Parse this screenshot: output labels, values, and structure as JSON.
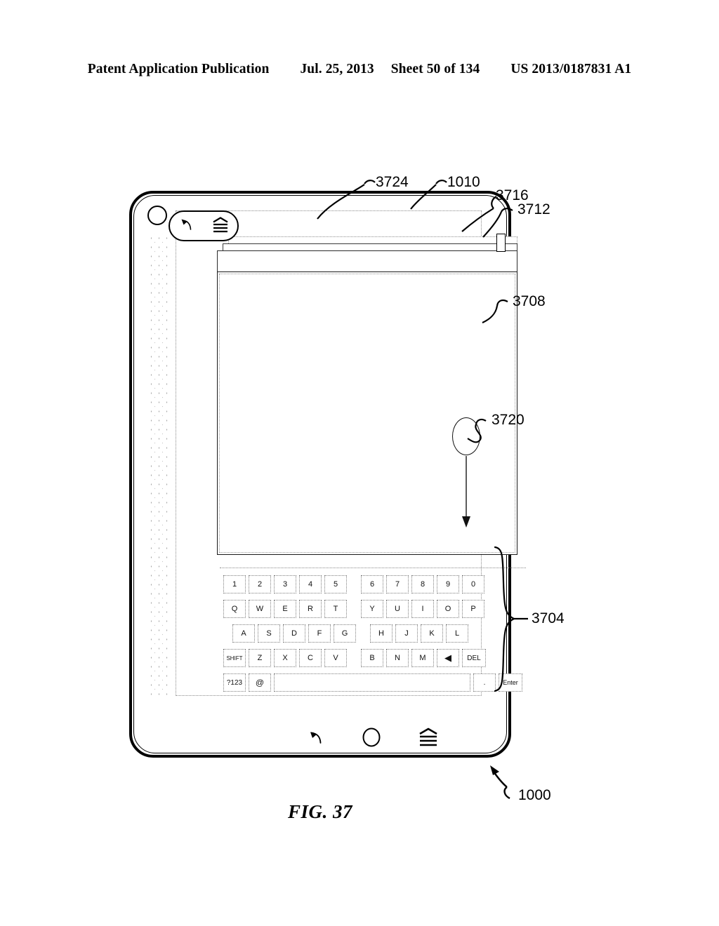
{
  "header": {
    "left": "Patent Application Publication",
    "date": "Jul. 25, 2013",
    "sheet": "Sheet 50 of 134",
    "pub_number": "US 2013/0187831 A1"
  },
  "figure": {
    "caption": "FIG. 37"
  },
  "reference_numerals": {
    "device": "1000",
    "window_1010": "1010",
    "pill_toolbar": "3724",
    "stack_top": "3716",
    "side_element": "3712",
    "content_panel": "3708",
    "touch_gesture": "3720",
    "keyboard": "3704"
  },
  "pill_toolbar": {
    "back_icon": "back-arrow-icon",
    "menu_icon": "menu-chevron-icon"
  },
  "nav_bar": {
    "back_icon": "back-arrow-icon",
    "home_icon": "home-circle-icon",
    "menu_icon": "menu-chevron-icon"
  },
  "keyboard": {
    "rows": [
      {
        "name": "number-row",
        "indent": 0,
        "keys": [
          {
            "label": "1",
            "style": "key-w"
          },
          {
            "label": "2",
            "style": "key-w"
          },
          {
            "label": "3",
            "style": "key-w"
          },
          {
            "label": "4",
            "style": "key-w"
          },
          {
            "label": "5",
            "style": "key-w"
          },
          {
            "label": "",
            "style": "split"
          },
          {
            "label": "6",
            "style": "key-w"
          },
          {
            "label": "7",
            "style": "key-w"
          },
          {
            "label": "8",
            "style": "key-w"
          },
          {
            "label": "9",
            "style": "key-w"
          },
          {
            "label": "0",
            "style": "key-w"
          }
        ]
      },
      {
        "name": "qwerty-row",
        "indent": 0,
        "keys": [
          {
            "label": "Q",
            "style": "key-w"
          },
          {
            "label": "W",
            "style": "key-w"
          },
          {
            "label": "E",
            "style": "key-w"
          },
          {
            "label": "R",
            "style": "key-w"
          },
          {
            "label": "T",
            "style": "key-w"
          },
          {
            "label": "",
            "style": "split"
          },
          {
            "label": "Y",
            "style": "key-w"
          },
          {
            "label": "U",
            "style": "key-w"
          },
          {
            "label": "I",
            "style": "key-w"
          },
          {
            "label": "O",
            "style": "key-w"
          },
          {
            "label": "P",
            "style": "key-w"
          }
        ]
      },
      {
        "name": "asdf-row",
        "indent": 1,
        "keys": [
          {
            "label": "A",
            "style": "key-w"
          },
          {
            "label": "S",
            "style": "key-w"
          },
          {
            "label": "D",
            "style": "key-w"
          },
          {
            "label": "F",
            "style": "key-w"
          },
          {
            "label": "G",
            "style": "key-w"
          },
          {
            "label": "",
            "style": "split"
          },
          {
            "label": "H",
            "style": "key-w"
          },
          {
            "label": "J",
            "style": "key-w"
          },
          {
            "label": "K",
            "style": "key-w"
          },
          {
            "label": "L",
            "style": "key-w"
          }
        ]
      },
      {
        "name": "zxcv-row",
        "indent": 2,
        "keys": [
          {
            "label": "SHIFT",
            "style": "key-shift"
          },
          {
            "label": "Z",
            "style": "key-w"
          },
          {
            "label": "X",
            "style": "key-w"
          },
          {
            "label": "C",
            "style": "key-w"
          },
          {
            "label": "V",
            "style": "key-w"
          },
          {
            "label": "",
            "style": "split"
          },
          {
            "label": "B",
            "style": "key-w"
          },
          {
            "label": "N",
            "style": "key-w"
          },
          {
            "label": "M",
            "style": "key-w"
          },
          {
            "label": "◀",
            "style": "key-arrow"
          },
          {
            "label": "DEL",
            "style": "key-del"
          }
        ]
      },
      {
        "name": "space-row",
        "indent": 2,
        "keys": [
          {
            "label": "?123",
            "style": "key-123"
          },
          {
            "label": "@",
            "style": "key-at"
          },
          {
            "label": "",
            "style": "key-space"
          },
          {
            "label": ".",
            "style": "key-dot"
          },
          {
            "label": "Enter",
            "style": "key-enter"
          }
        ]
      }
    ]
  }
}
